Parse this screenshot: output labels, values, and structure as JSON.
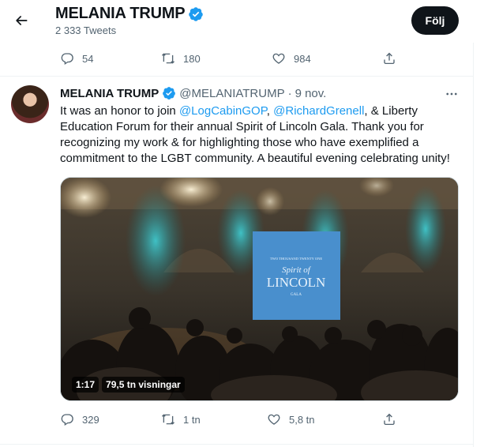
{
  "header": {
    "title": "MELANIA TRUMP",
    "tweet_count": "2 333 Tweets",
    "follow_label": "Följ"
  },
  "prev_tweet_actions": {
    "replies": "54",
    "retweets": "180",
    "likes": "984"
  },
  "tweet": {
    "name": "MELANIA TRUMP",
    "handle": "@MELANIATRUMP",
    "separator": "·",
    "date": "9 nov.",
    "text_parts": {
      "t1": "It was an honor to join ",
      "m1": "@LogCabinGOP",
      "t2": ", ",
      "m2": "@RichardGrenell",
      "t3": ", & Liberty Education Forum for their annual Spirit of Lincoln Gala. Thank you for recognizing my work & for highlighting those who have exemplified a commitment to the LGBT community. A beautiful evening celebrating unity!"
    },
    "video": {
      "duration": "1:17",
      "views": "79,5 tn visningar",
      "screen_line1": "TWO THOUSAND TWENTY ONE",
      "screen_line2": "Spirit of",
      "screen_line3": "LINCOLN",
      "screen_line4": "GALA"
    },
    "actions": {
      "replies": "329",
      "retweets": "1 tn",
      "likes": "5,8 tn"
    }
  },
  "colors": {
    "accent": "#1d9bf0",
    "text_secondary": "#536471",
    "button_bg": "#0f1419"
  },
  "icons": [
    "back-arrow-icon",
    "verified-badge-icon",
    "reply-icon",
    "retweet-icon",
    "like-icon",
    "share-icon",
    "more-icon"
  ]
}
